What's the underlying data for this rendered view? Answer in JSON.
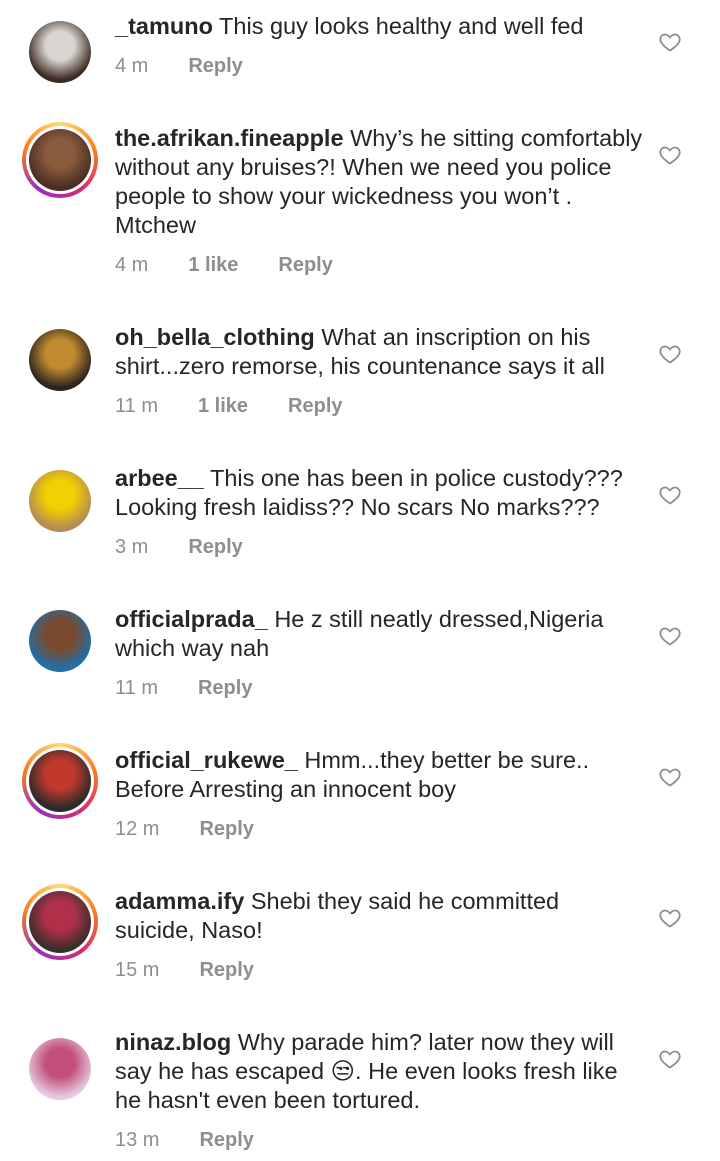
{
  "comments": [
    {
      "username": "_tamuno",
      "text": "This guy looks healthy and well fed",
      "time": "4 m",
      "likes": "",
      "reply": "Reply",
      "story_ring": false,
      "avatar_colors": [
        "#3b2a22",
        "#d9d4cf"
      ]
    },
    {
      "username": "the.afrikan.fineapple",
      "text": "Why’s he sitting comfortably without any bruises?! When we need you police people to show your wickedness you won’t . Mtchew",
      "time": "4 m",
      "likes": "1 like",
      "reply": "Reply",
      "story_ring": true,
      "avatar_colors": [
        "#4a2e24",
        "#8a5a3c"
      ]
    },
    {
      "username": "oh_bella_clothing",
      "text": "What an inscription on his shirt...zero remorse, his countenance says it all",
      "time": "11 m",
      "likes": "1 like",
      "reply": "Reply",
      "story_ring": false,
      "avatar_colors": [
        "#2b2320",
        "#c08a2e"
      ]
    },
    {
      "username": "arbee__",
      "text": "This one has been in police custody??? Looking fresh laidiss?? No scars No marks???",
      "time": "3 m",
      "likes": "",
      "reply": "Reply",
      "story_ring": false,
      "avatar_colors": [
        "#b58a55",
        "#f0d000"
      ]
    },
    {
      "username": "officialprada_",
      "text": "He z still neatly dressed,Nigeria which way nah",
      "time": "11 m",
      "likes": "",
      "reply": "Reply",
      "story_ring": false,
      "avatar_colors": [
        "#1f6fa8",
        "#7a4a2e"
      ]
    },
    {
      "username": "official_rukewe_",
      "text": "Hmm...they better be sure.. Before Arresting an innocent boy",
      "time": "12 m",
      "likes": "",
      "reply": "Reply",
      "story_ring": true,
      "avatar_colors": [
        "#2a2a2a",
        "#c0392b"
      ]
    },
    {
      "username": "adamma.ify",
      "text": "Shebi they said he committed suicide, Naso!",
      "time": "15 m",
      "likes": "",
      "reply": "Reply",
      "story_ring": true,
      "avatar_colors": [
        "#3a2e2a",
        "#b0304a"
      ]
    },
    {
      "username": "ninaz.blog",
      "text": "Why parade him? later now they will say he has escaped 😒. He even looks fresh like he hasn't even been tortured.",
      "time": "13 m",
      "likes": "",
      "reply": "Reply",
      "story_ring": false,
      "avatar_colors": [
        "#e7c7e0",
        "#c2507a"
      ]
    }
  ],
  "icons": {
    "like": "heart-outline-icon"
  },
  "colors": {
    "text": "#262626",
    "meta": "#8e8e8e",
    "heart": "#8e8e8e"
  }
}
